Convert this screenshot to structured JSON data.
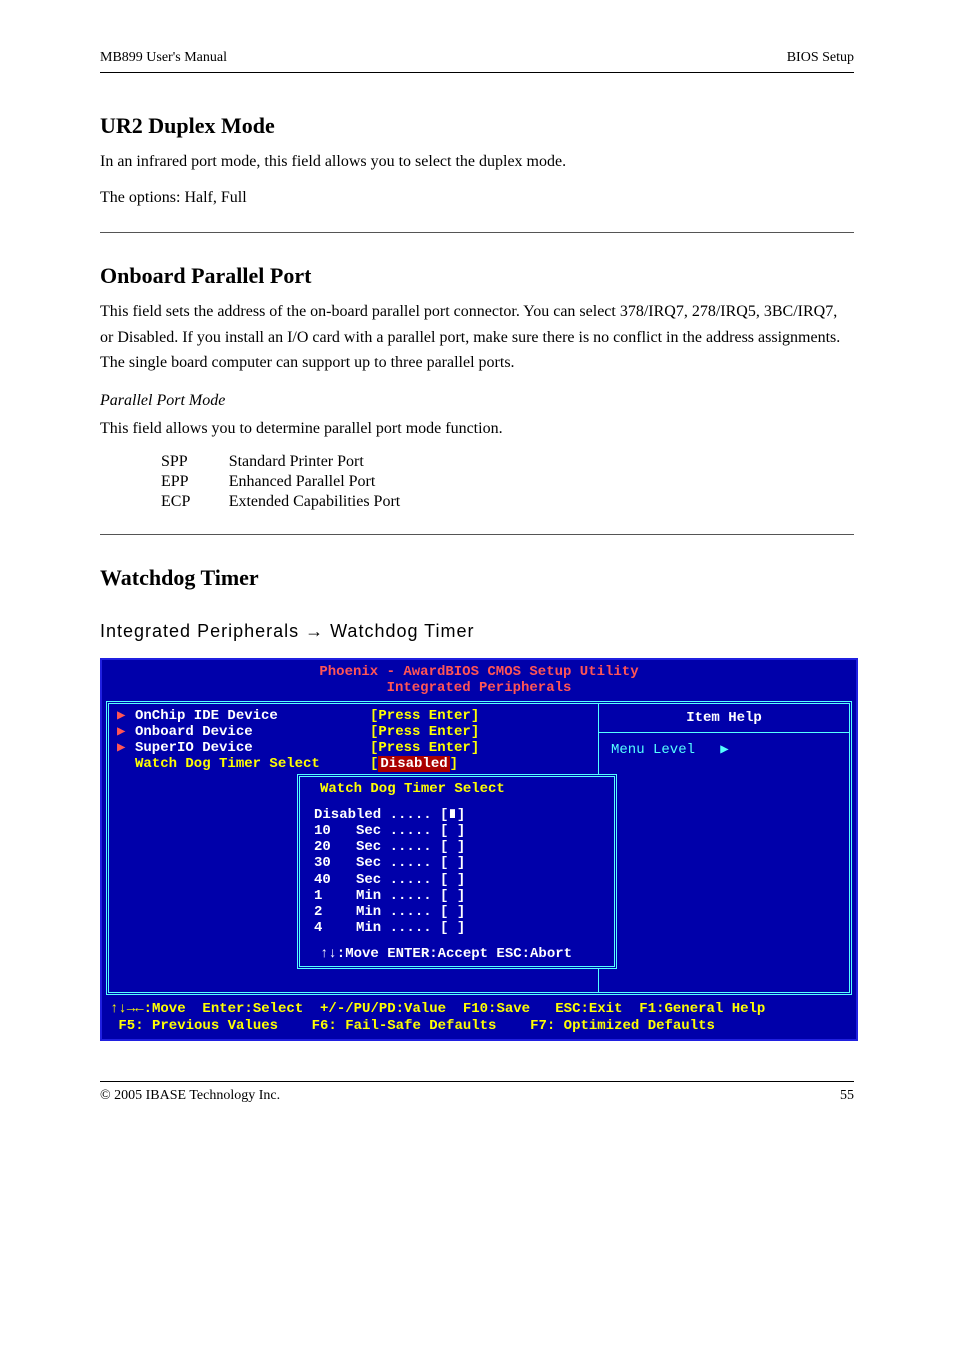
{
  "header": {
    "left": "MB899 User's Manual",
    "right": "BIOS Setup"
  },
  "section1": {
    "heading": "UR2 Duplex Mode",
    "body": "In an infrared port mode, this field allows you to select the duplex mode.",
    "options_label": "The options:",
    "options": "Half, Full"
  },
  "section2": {
    "heading": "Onboard Parallel Port",
    "body": "This field sets the address of the on-board parallel port connector. You can select 378/IRQ7, 278/IRQ5, 3BC/IRQ7, or Disabled. If you install an I/O card with a parallel port, make sure there is no conflict in the address assignments. The single board computer can support up to three parallel ports.",
    "sub_italic": "Parallel Port Mode",
    "sub_body": "This field allows you to determine parallel port mode function.",
    "mode_rows": [
      {
        "k": "SPP",
        "v": "Standard Printer Port"
      },
      {
        "k": "EPP",
        "v": "Enhanced Parallel Port"
      },
      {
        "k": "ECP",
        "v": "Extended Capabilities Port"
      }
    ]
  },
  "section3": {
    "heading": "Watchdog Timer",
    "menu_location": "Integrated Peripherals → Watchdog Timer"
  },
  "bios": {
    "title_line1": "Phoenix - AwardBIOS CMOS Setup Utility",
    "title_line2": "Integrated Peripherals",
    "menu": [
      {
        "label": "OnChip IDE Device",
        "value": "[Press Enter]",
        "tri": true
      },
      {
        "label": "Onboard Device",
        "value": "[Press Enter]",
        "tri": true
      },
      {
        "label": "SuperIO Device",
        "value": "[Press Enter]",
        "tri": true
      },
      {
        "label": "Watch Dog Timer Select",
        "value_pre": "[",
        "value_sel": "Disabled",
        "value_post": "]",
        "tri": false
      }
    ],
    "help_title": "Item Help",
    "menu_level": "Menu Level",
    "popup": {
      "title": "Watch Dog Timer Select",
      "options": [
        "Disabled ..... [∎]",
        "10   Sec ..... [ ]",
        "20   Sec ..... [ ]",
        "30   Sec ..... [ ]",
        "40   Sec ..... [ ]",
        "1    Min ..... [ ]",
        "2    Min ..... [ ]",
        "4    Min ..... [ ]"
      ],
      "hint": "↑↓:Move ENTER:Accept ESC:Abort"
    },
    "footer_line1": "↑↓→←:Move  Enter:Select  +/-/PU/PD:Value  F10:Save   ESC:Exit  F1:General Help",
    "footer_line2": " F5: Previous Values    F6: Fail-Safe Defaults    F7: Optimized Defaults"
  },
  "footer": {
    "left": "© 2005 IBASE Technology Inc.",
    "right": "55"
  }
}
